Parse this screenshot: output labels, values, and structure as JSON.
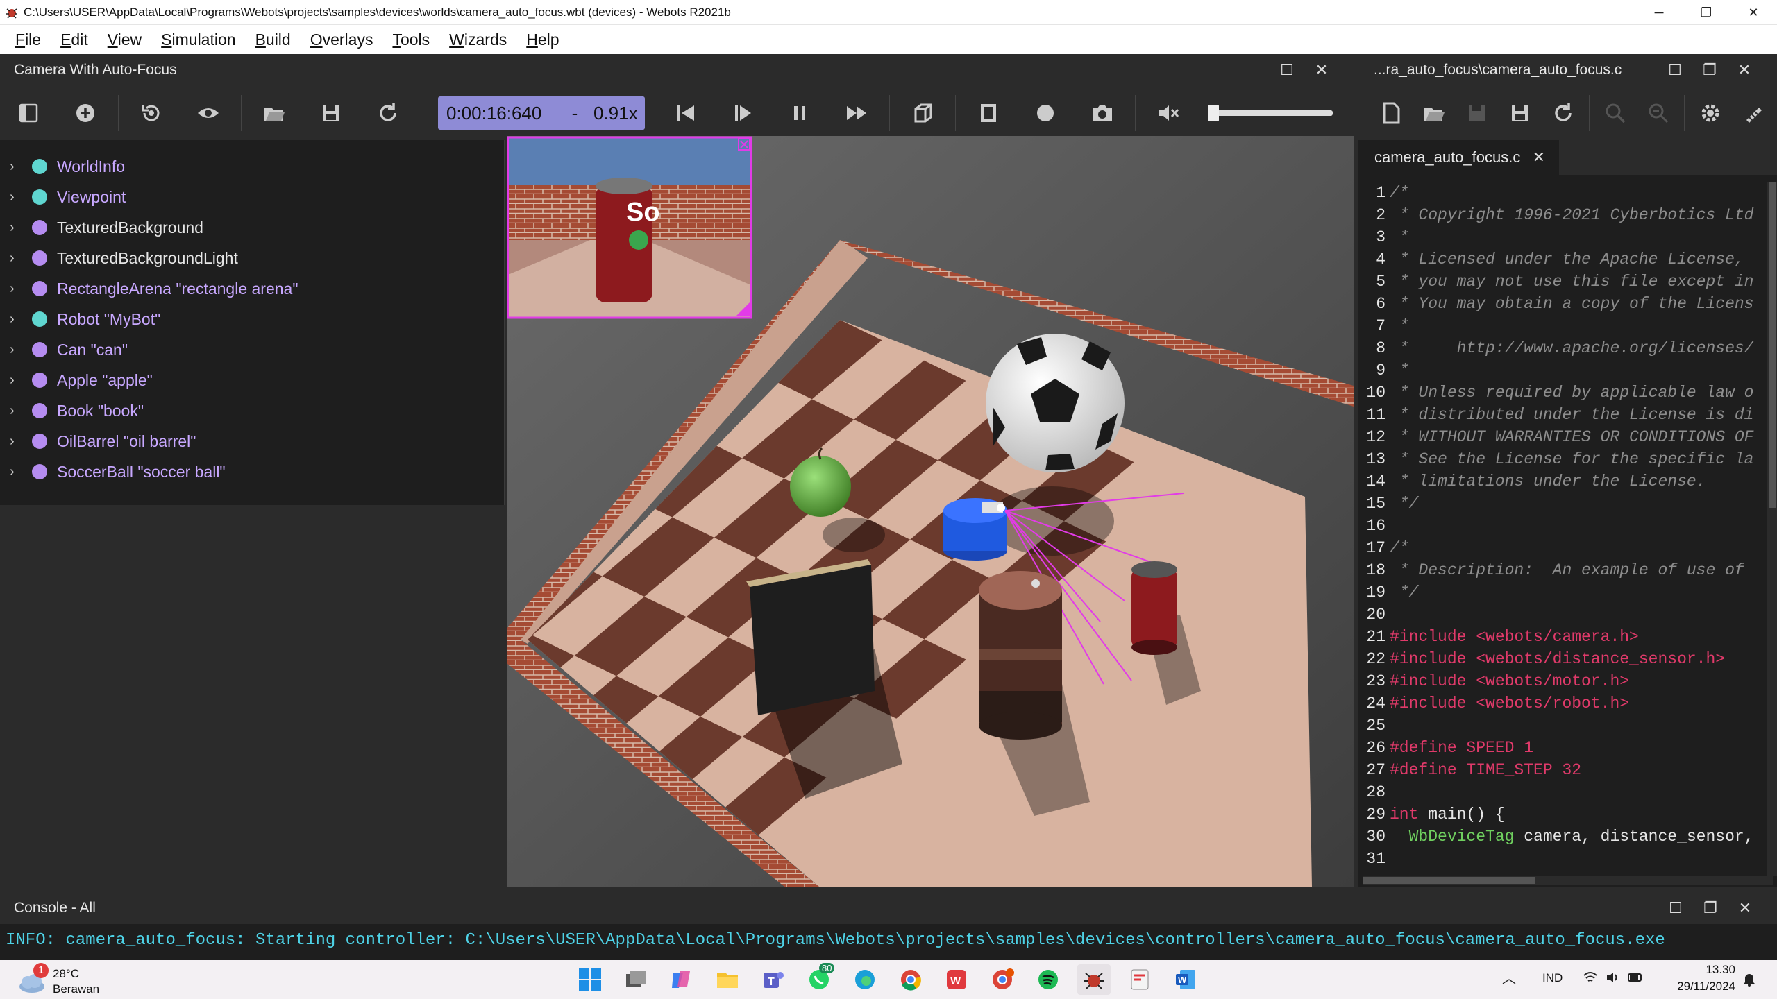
{
  "window": {
    "title": "C:\\Users\\USER\\AppData\\Local\\Programs\\Webots\\projects\\samples\\devices\\worlds\\camera_auto_focus.wbt (devices) - Webots R2021b",
    "minimize": "─",
    "maximize": "❐",
    "close": "✕"
  },
  "menu": [
    {
      "first": "F",
      "rest": "ile"
    },
    {
      "first": "E",
      "rest": "dit"
    },
    {
      "first": "V",
      "rest": "iew"
    },
    {
      "first": "S",
      "rest": "imulation"
    },
    {
      "first": "B",
      "rest": "uild"
    },
    {
      "first": "O",
      "rest": "verlays"
    },
    {
      "first": "T",
      "rest": "ools"
    },
    {
      "first": "W",
      "rest": "izards"
    },
    {
      "first": "H",
      "rest": "elp"
    }
  ],
  "scene_panel": {
    "title": "Camera With Auto-Focus"
  },
  "editor_panel": {
    "title": "...ra_auto_focus\\camera_auto_focus.c"
  },
  "simulation": {
    "time": "0:00:16:640",
    "separator": "-",
    "speed": "0.91x"
  },
  "tree": [
    {
      "label": "WorldInfo",
      "color": "#5fd6d0",
      "highlight": true
    },
    {
      "label": "Viewpoint",
      "color": "#5fd6d0",
      "highlight": true
    },
    {
      "label": "TexturedBackground",
      "color": "#b58cf0",
      "highlight": false
    },
    {
      "label": "TexturedBackgroundLight",
      "color": "#b58cf0",
      "highlight": false
    },
    {
      "label": "RectangleArena \"rectangle arena\"",
      "color": "#b58cf0",
      "highlight": true
    },
    {
      "label": "Robot \"MyBot\"",
      "color": "#5fd6d0",
      "highlight": true
    },
    {
      "label": "Can \"can\"",
      "color": "#b58cf0",
      "highlight": true
    },
    {
      "label": "Apple \"apple\"",
      "color": "#b58cf0",
      "highlight": true
    },
    {
      "label": "Book \"book\"",
      "color": "#b58cf0",
      "highlight": true
    },
    {
      "label": "OilBarrel \"oil barrel\"",
      "color": "#b58cf0",
      "highlight": true
    },
    {
      "label": "SoccerBall \"soccer ball\"",
      "color": "#b58cf0",
      "highlight": true
    }
  ],
  "editor": {
    "tab": "camera_auto_focus.c",
    "lines": [
      [
        {
          "t": "/*",
          "c": "com"
        }
      ],
      [
        {
          "t": " * Copyright 1996-2021 Cyberbotics Ltd",
          "c": "com"
        }
      ],
      [
        {
          "t": " *",
          "c": "com"
        }
      ],
      [
        {
          "t": " * Licensed under the Apache License, ",
          "c": "com"
        }
      ],
      [
        {
          "t": " * you may not use this file except in",
          "c": "com"
        }
      ],
      [
        {
          "t": " * You may obtain a copy of the Licens",
          "c": "com"
        }
      ],
      [
        {
          "t": " *",
          "c": "com"
        }
      ],
      [
        {
          "t": " *     http://www.apache.org/licenses/",
          "c": "com"
        }
      ],
      [
        {
          "t": " *",
          "c": "com"
        }
      ],
      [
        {
          "t": " * Unless required by applicable law o",
          "c": "com"
        }
      ],
      [
        {
          "t": " * distributed under the License is di",
          "c": "com"
        }
      ],
      [
        {
          "t": " * WITHOUT WARRANTIES OR CONDITIONS OF",
          "c": "com"
        }
      ],
      [
        {
          "t": " * See the License for the specific la",
          "c": "com"
        }
      ],
      [
        {
          "t": " * limitations under the License.",
          "c": "com"
        }
      ],
      [
        {
          "t": " */",
          "c": "com"
        }
      ],
      [
        {
          "t": "",
          "c": ""
        }
      ],
      [
        {
          "t": "/*",
          "c": "com"
        }
      ],
      [
        {
          "t": " * Description:  An example of use of ",
          "c": "com"
        }
      ],
      [
        {
          "t": " */",
          "c": "com"
        }
      ],
      [
        {
          "t": "",
          "c": ""
        }
      ],
      [
        {
          "t": "#include <webots/camera.h>",
          "c": "pre"
        }
      ],
      [
        {
          "t": "#include <webots/distance_sensor.h>",
          "c": "pre"
        }
      ],
      [
        {
          "t": "#include <webots/motor.h>",
          "c": "pre"
        }
      ],
      [
        {
          "t": "#include <webots/robot.h>",
          "c": "pre"
        }
      ],
      [
        {
          "t": "",
          "c": ""
        }
      ],
      [
        {
          "t": "#define SPEED 1",
          "c": "pre"
        }
      ],
      [
        {
          "t": "#define TIME_STEP 32",
          "c": "pre"
        }
      ],
      [
        {
          "t": "",
          "c": ""
        }
      ],
      [
        {
          "t": "int",
          "c": "pre"
        },
        {
          "t": " main() {",
          "c": ""
        }
      ],
      [
        {
          "t": "  WbDeviceTag",
          "c": "typ"
        },
        {
          "t": " camera, distance_sensor,",
          "c": ""
        }
      ],
      [
        {
          "t": "",
          "c": ""
        }
      ]
    ]
  },
  "console": {
    "title": "Console - All",
    "line": "INFO: camera_auto_focus: Starting controller: C:\\Users\\USER\\AppData\\Local\\Programs\\Webots\\projects\\samples\\devices\\controllers\\camera_auto_focus\\camera_auto_focus.exe"
  },
  "camera_overlay": {
    "text": "So"
  },
  "taskbar": {
    "weather_temp": "28°C",
    "weather_desc": "Berawan",
    "weather_badge": "1",
    "whatsapp_badge": "80",
    "lang": "IND",
    "time": "13.30",
    "date": "29/11/2024"
  }
}
